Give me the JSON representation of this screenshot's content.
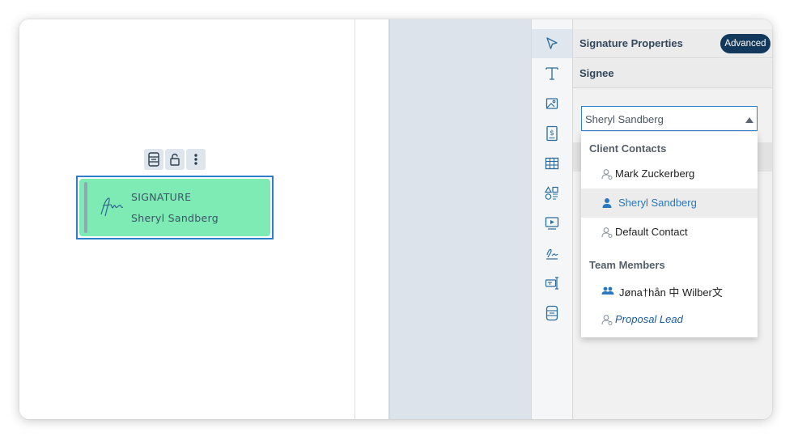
{
  "signature_block": {
    "label": "SIGNATURE",
    "signee_name": "Sheryl Sandberg"
  },
  "floating_toolbar": {
    "icons": [
      "field-settings-icon",
      "unlock-icon",
      "more-vertical-icon"
    ]
  },
  "icon_rail": {
    "items": [
      {
        "icon": "pointer-icon",
        "active": true
      },
      {
        "icon": "text-icon"
      },
      {
        "icon": "image-icon"
      },
      {
        "icon": "pricing-icon"
      },
      {
        "icon": "table-icon"
      },
      {
        "icon": "shapes-icon"
      },
      {
        "icon": "video-icon"
      },
      {
        "icon": "signature-icon"
      },
      {
        "icon": "text-field-icon"
      },
      {
        "icon": "form-field-icon"
      }
    ]
  },
  "properties": {
    "title": "Signature Properties",
    "advanced_label": "Advanced",
    "signee_section": "Signee",
    "signee_select": {
      "value": "Sheryl Sandberg"
    },
    "dropdown": {
      "groups": [
        {
          "label": "Client Contacts",
          "options": [
            {
              "label": "Mark Zuckerberg",
              "icon": "contact-icon"
            },
            {
              "label": "Sheryl Sandberg",
              "icon": "person-icon",
              "selected": true
            },
            {
              "label": "Default Contact",
              "icon": "contact-icon"
            }
          ]
        },
        {
          "label": "Team Members",
          "options": [
            {
              "label": "Jøna†hån 中 Wilber文",
              "icon": "team-icon"
            },
            {
              "label": "Proposal Lead",
              "icon": "contact-icon",
              "italic": true
            }
          ]
        }
      ]
    }
  },
  "colors": {
    "accent": "#2c7fc8",
    "signature_fill": "#7eeab4",
    "advanced_button": "#12385c"
  }
}
